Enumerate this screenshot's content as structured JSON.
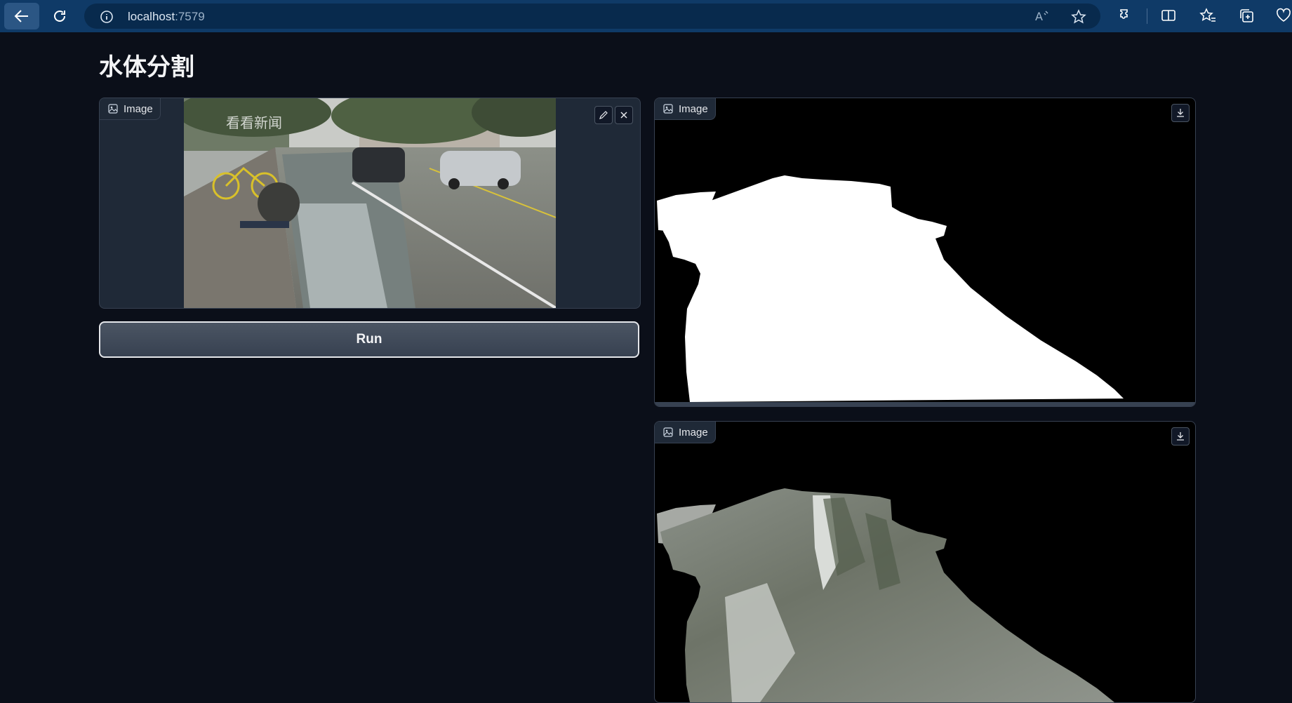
{
  "browser": {
    "url_host": "localhost",
    "url_port": ":7579"
  },
  "page": {
    "title": "水体分割",
    "run_label": "Run"
  },
  "input_panel": {
    "label": "Image",
    "photo_watermark": "看看新闻"
  },
  "output_mask": {
    "label": "Image"
  },
  "output_overlay": {
    "label": "Image"
  }
}
